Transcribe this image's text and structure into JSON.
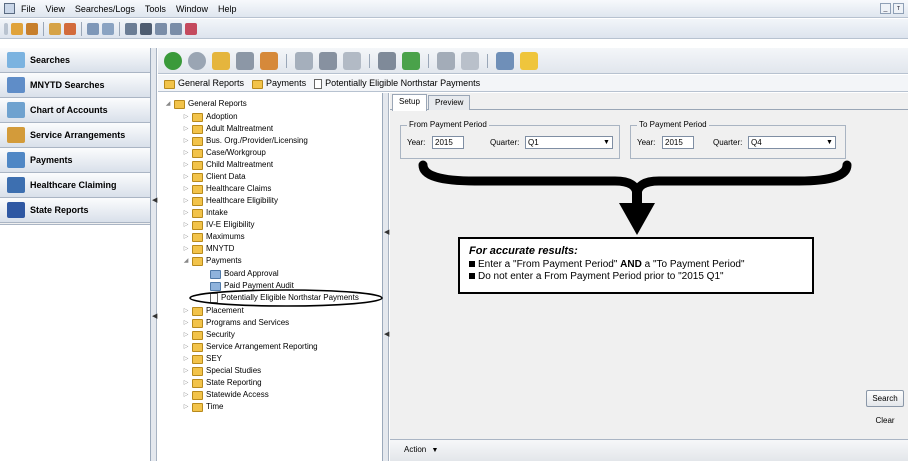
{
  "menu": {
    "items": [
      "File",
      "View",
      "Searches/Logs",
      "Tools",
      "Window",
      "Help"
    ]
  },
  "window_controls": [
    "_",
    "т"
  ],
  "nav": {
    "items": [
      {
        "label": "Searches",
        "icon": "magnifier-icon",
        "color": "#7bb3e0"
      },
      {
        "label": "MNYTD Searches",
        "icon": "people-icon",
        "color": "#5f8dc8"
      },
      {
        "label": "Chart of Accounts",
        "icon": "ledger-icon",
        "color": "#6fa2cf"
      },
      {
        "label": "Service Arrangements",
        "icon": "handshake-icon",
        "color": "#d39b3a"
      },
      {
        "label": "Payments",
        "icon": "payment-card-icon",
        "color": "#4f87c5"
      },
      {
        "label": "Healthcare Claiming",
        "icon": "medical-cross-icon",
        "color": "#3d6fb0"
      },
      {
        "label": "State Reports",
        "icon": "state-flag-icon",
        "color": "#2f58a3"
      }
    ]
  },
  "breadcrumb": {
    "items": [
      "General Reports",
      "Payments",
      "Potentially Eligible Northstar Payments"
    ]
  },
  "tree": {
    "root": "General Reports",
    "nodes": [
      "Adoption",
      "Adult Maltreatment",
      "Bus. Org./Provider/Licensing",
      "Case/Workgroup",
      "Child Maltreatment",
      "Client Data",
      "Healthcare Claims",
      "Healthcare Eligibility",
      "Intake",
      "IV-E Eligibility",
      "Maximums",
      "MNYTD",
      "Payments"
    ],
    "payments_children": [
      "Board Approval",
      "Paid Payment Audit",
      "Potentially Eligible Northstar Payments"
    ],
    "nodes_after": [
      "Placement",
      "Programs and Services",
      "Security",
      "Service Arrangement Reporting",
      "SEY",
      "Special Studies",
      "State Reporting",
      "Statewide Access",
      "Time"
    ]
  },
  "tabs": {
    "setup": "Setup",
    "preview": "Preview"
  },
  "from_period": {
    "legend": "From Payment Period",
    "year_label": "Year:",
    "year_value": "2015",
    "quarter_label": "Quarter:",
    "quarter_value": "Q1"
  },
  "to_period": {
    "legend": "To Payment Period",
    "year_label": "Year:",
    "year_value": "2015",
    "quarter_label": "Quarter:",
    "quarter_value": "Q4"
  },
  "callout": {
    "title": "For accurate results:",
    "line1_a": "Enter a \"From Payment Period\" ",
    "line1_b": "AND",
    "line1_c": " a \"To Payment Period\"",
    "line2": "Do not enter a From Payment Period prior to \"2015 Q1\""
  },
  "buttons": {
    "search": "Search",
    "clear": "Clear",
    "action": "Action"
  }
}
